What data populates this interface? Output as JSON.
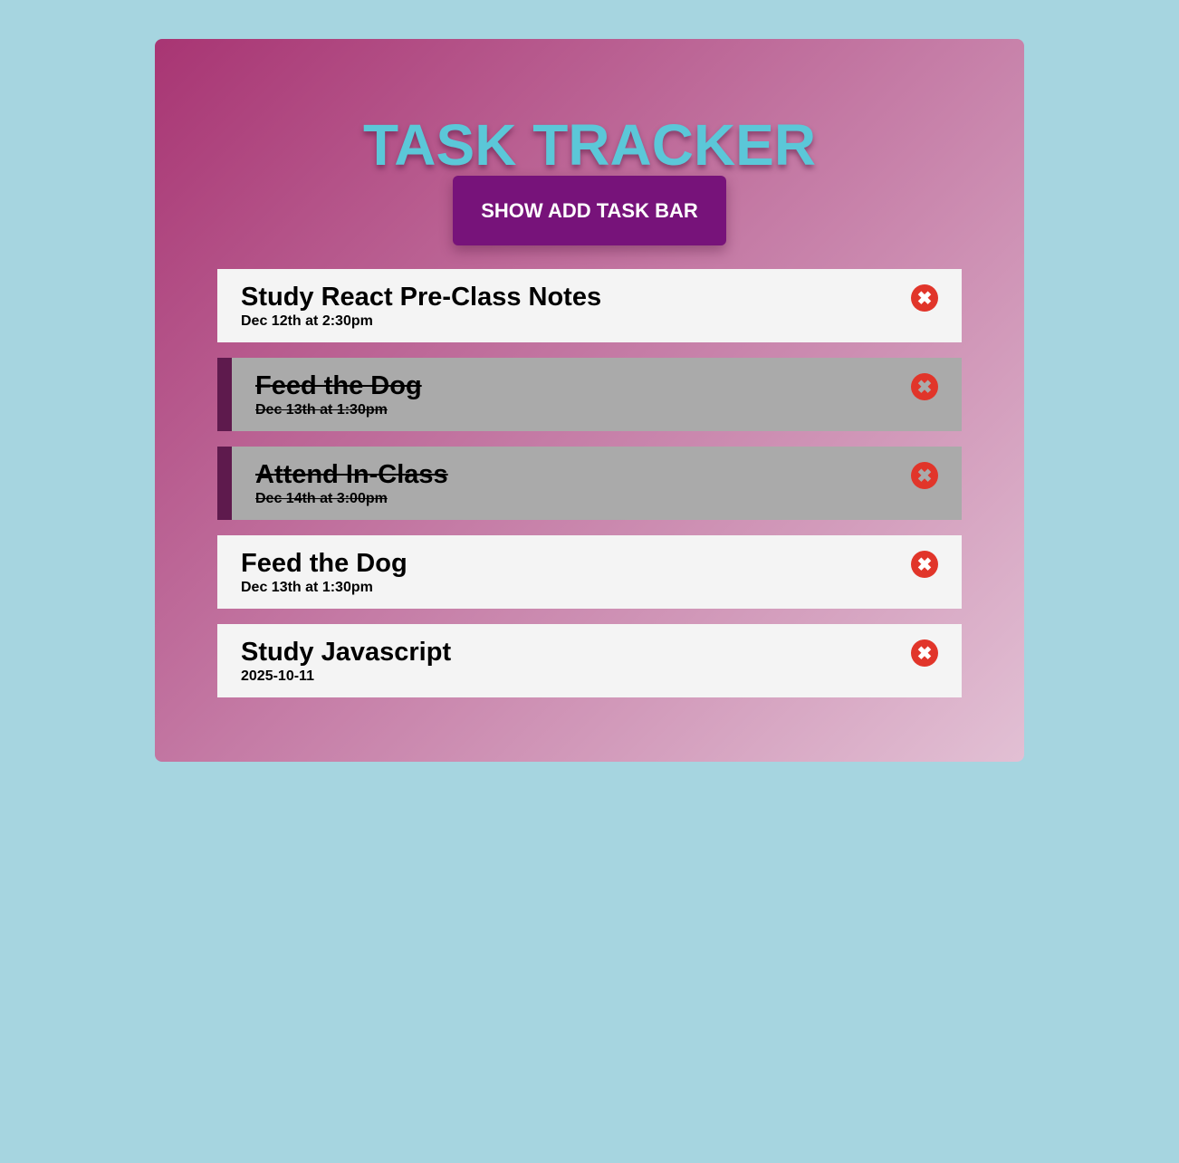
{
  "header": {
    "title": "TASK TRACKER",
    "toggle_button": "SHOW ADD TASK BAR"
  },
  "tasks": [
    {
      "text": "Study React Pre-Class Notes",
      "day": "Dec 12th at 2:30pm",
      "completed": false
    },
    {
      "text": "Feed the Dog",
      "day": "Dec 13th at 1:30pm",
      "completed": true
    },
    {
      "text": "Attend In-Class",
      "day": "Dec 14th at 3:00pm",
      "completed": true
    },
    {
      "text": "Feed the Dog",
      "day": "Dec 13th at 1:30pm",
      "completed": false
    },
    {
      "text": "Study Javascript",
      "day": "2025-10-11",
      "completed": false
    }
  ],
  "icons": {
    "delete": "✖"
  }
}
